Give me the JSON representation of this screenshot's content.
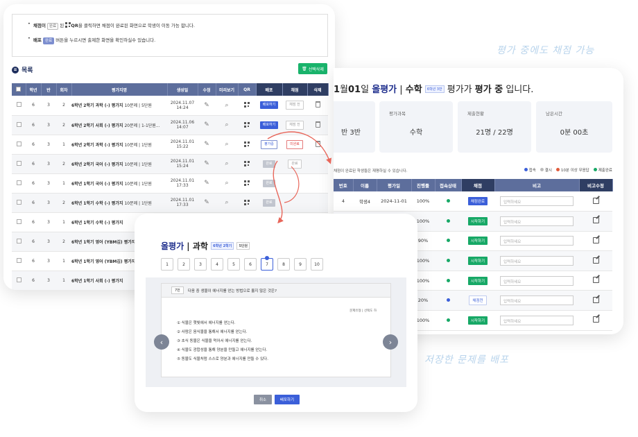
{
  "annotations": {
    "grading_during_eval": "평가 중에도 채점 가능",
    "distribute_saved": "저장한 문제를 배포"
  },
  "left": {
    "notice": {
      "line1_prefix": "채점이",
      "line1_btn": "완료",
      "line1_mid": "된",
      "line1_qr": "QR",
      "line1_suffix": "을 클릭하면 채점이 완료된 화면으로 학생이 이동 가능 합니다.",
      "line2_prefix": "배포",
      "line2_btn": "완료",
      "line2_suffix": "버튼을 누르시면 출제한 화면을 확인하실수 있습니다."
    },
    "list_title": "목록",
    "delete_selected": "선택삭제",
    "columns": [
      "",
      "학년",
      "반",
      "회차",
      "평가지명",
      "생성일",
      "수정",
      "미리보기",
      "QR",
      "배포",
      "채점",
      "삭제"
    ],
    "rows": [
      {
        "grade": "6",
        "class": "3",
        "round": "2",
        "title": "6학년 2학기 과학 (-) 평가지",
        "sub": "10문제 | 5단원",
        "date": "2024.11.07",
        "time": "14:24",
        "dist": "배포하기",
        "dist_style": "blue",
        "score": "채점 전",
        "score_style": "outline"
      },
      {
        "grade": "6",
        "class": "3",
        "round": "2",
        "title": "6학년 2학기 사회 (-) 평가지",
        "sub": "20문제 | 1-1단원...",
        "date": "2024.11.06",
        "time": "14:07",
        "dist": "배포하기",
        "dist_style": "blue",
        "score": "채점 전",
        "score_style": "outline"
      },
      {
        "grade": "6",
        "class": "3",
        "round": "1",
        "title": "6학년 2학기 과학 (-) 평가지",
        "sub": "10문제 | 1단원",
        "date": "2024.11.01",
        "time": "15:22",
        "dist": "평가중",
        "dist_style": "outline-blue",
        "score": "미완료",
        "score_style": "outline-red"
      },
      {
        "grade": "6",
        "class": "3",
        "round": "2",
        "title": "6학년 2학기 국어 (-) 평가지",
        "sub": "10문제 | 1단원",
        "date": "2024.11.01",
        "time": "15:24",
        "dist": "완료",
        "dist_style": "grey",
        "score": "완료",
        "score_style": "outline"
      },
      {
        "grade": "6",
        "class": "3",
        "round": "1",
        "title": "6학년 1학기 국어 (-) 평가지",
        "sub": "10문제 | 1단원",
        "date": "2024.11.01",
        "time": "17:33",
        "dist": "완료",
        "dist_style": "grey",
        "score": "",
        "score_style": ""
      },
      {
        "grade": "6",
        "class": "3",
        "round": "2",
        "title": "6학년 1학기 수학 (-) 평가지",
        "sub": "10문제 | 1단원",
        "date": "2024.11.01",
        "time": "17:33",
        "dist": "완료",
        "dist_style": "grey",
        "score": "",
        "score_style": ""
      },
      {
        "grade": "6",
        "class": "3",
        "round": "1",
        "title": "6학년 1학기 수학 (-) 평가지",
        "sub": "",
        "date": "",
        "time": "",
        "dist": "",
        "dist_style": "",
        "score": "",
        "score_style": ""
      },
      {
        "grade": "6",
        "class": "3",
        "round": "2",
        "title": "6학년 1학기 영어 (YBM김) 평가지",
        "sub": "",
        "date": "",
        "time": "",
        "dist": "",
        "dist_style": "",
        "score": "",
        "score_style": ""
      },
      {
        "grade": "6",
        "class": "3",
        "round": "1",
        "title": "6학년 1학기 영어 (YBM김) 평가지",
        "sub": "",
        "date": "",
        "time": "",
        "dist": "",
        "dist_style": "",
        "score": "",
        "score_style": ""
      },
      {
        "grade": "6",
        "class": "3",
        "round": "1",
        "title": "6학년 1학기 사회 (-) 평가지",
        "sub": "",
        "date": "",
        "time": "",
        "dist": "",
        "dist_style": "",
        "score": "",
        "score_style": ""
      }
    ]
  },
  "right": {
    "header": {
      "date_prefix": "1",
      "month_unit": "월",
      "day": "01",
      "day_unit": "일",
      "logo": "올평가",
      "subject": "수학",
      "badge": "6학년 3반",
      "middle": "평가가",
      "status": "평가 중",
      "suffix": "입니다."
    },
    "stats": [
      {
        "label": "",
        "value": "반 3반"
      },
      {
        "label": "평가과목",
        "value": "수학"
      },
      {
        "label": "제출현황",
        "value": "21명 / 22명"
      },
      {
        "label": "남은시간",
        "value": "0분 00초"
      }
    ],
    "note": "채점이 완료된 학생들은 재평하실 수 있습니다.",
    "legend": [
      {
        "label": "접속",
        "color": "#3b5fd9"
      },
      {
        "label": "결시",
        "color": "#bbbbbb"
      },
      {
        "label": "10분 이상 무응답",
        "color": "#e05a3a"
      },
      {
        "label": "제출완료",
        "color": "#17a866"
      }
    ],
    "columns": [
      "번호",
      "이름",
      "평가일",
      "진행률",
      "접속상태",
      "채점",
      "비고",
      "비고수정"
    ],
    "rows": [
      {
        "no": "4",
        "name": "학생4",
        "date": "2024-11-01",
        "progress": "100%",
        "status_color": "#17a866",
        "btn": "채점완료",
        "btn_style": "blue",
        "memo": "입력하세요"
      },
      {
        "no": "",
        "name": "",
        "date": "",
        "progress": "100%",
        "status_color": "#17a866",
        "btn": "시작하기",
        "btn_style": "green",
        "memo": "입력하세요"
      },
      {
        "no": "",
        "name": "",
        "date": "",
        "progress": "90%",
        "status_color": "#17a866",
        "btn": "시작하기",
        "btn_style": "green",
        "memo": "입력하세요"
      },
      {
        "no": "",
        "name": "",
        "date": "",
        "progress": "100%",
        "status_color": "#17a866",
        "btn": "시작하기",
        "btn_style": "green",
        "memo": "입력하세요"
      },
      {
        "no": "",
        "name": "",
        "date": "",
        "progress": "100%",
        "status_color": "#17a866",
        "btn": "시작하기",
        "btn_style": "green",
        "memo": "입력하세요"
      },
      {
        "no": "",
        "name": "",
        "date": "",
        "progress": "20%",
        "status_color": "#3b5fd9",
        "btn": "채점전",
        "btn_style": "out",
        "memo": "입력하세요"
      },
      {
        "no": "",
        "name": "",
        "date": "",
        "progress": "100%",
        "status_color": "#17a866",
        "btn": "시작하기",
        "btn_style": "green",
        "memo": "입력하세요"
      }
    ]
  },
  "center": {
    "logo": "올평가",
    "subject": "과학",
    "badge1": "6학년 2학기",
    "badge2": "5단원",
    "numbers": [
      "1",
      "2",
      "3",
      "4",
      "5",
      "6",
      "7",
      "8",
      "9",
      "10"
    ],
    "selected": "7",
    "question_no": "7번",
    "question": "다음 중 생물이 에너지를 얻는 방법으로 옳지 않은 것은?",
    "meta": "문제유형 | 선택도 하",
    "options": [
      "① 식물은 햇빛에서 에너지를 얻는다.",
      "② 사람은 음식물을 통해서 에너지를 얻는다.",
      "③ 초식 동물은 식물을 먹어서 에너지를 얻는다.",
      "④ 식물도 광합성을 통해 양분을 만들고 에너지를 얻는다.",
      "⑤ 동물도 식물처럼 스스로 양분과 에너지를 만들 수 있다."
    ],
    "cancel": "취소",
    "distribute": "배포하기"
  }
}
